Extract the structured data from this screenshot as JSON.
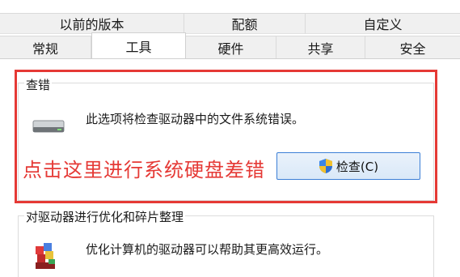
{
  "tabs_top": [
    "以前的版本",
    "配额",
    "自定义"
  ],
  "tabs_bottom": [
    "常规",
    "工具",
    "硬件",
    "共享",
    "安全"
  ],
  "active_tab": "工具",
  "error_check": {
    "group_title": "查错",
    "description": "此选项将检查驱动器中的文件系统错误。",
    "annotation": "点击这里进行系统硬盘差错",
    "button_label": "检查(C)"
  },
  "optimize": {
    "group_title": "对驱动器进行优化和碎片整理",
    "description": "优化计算机的驱动器可以帮助其更高效运行。"
  },
  "colors": {
    "annotation_red": "#e53935",
    "button_border": "#3c7fd6"
  },
  "icons": {
    "drive": "drive-icon",
    "shield": "shield-icon",
    "defrag": "defrag-icon"
  }
}
